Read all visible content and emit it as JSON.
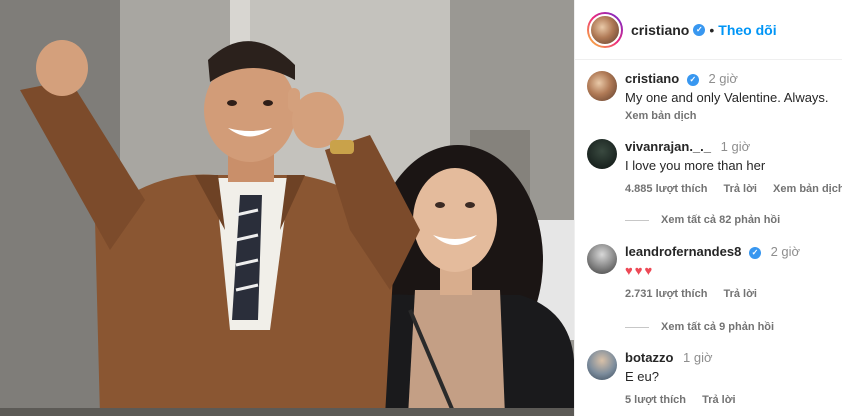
{
  "post": {
    "author": "cristiano",
    "follow_label": "Theo dõi",
    "dot": "•"
  },
  "caption": {
    "username": "cristiano",
    "time": "2 giờ",
    "text": "My one and only Valentine. Always.",
    "translate_label": "Xem bản dịch"
  },
  "comments": [
    {
      "username": "vivanrajan._._",
      "time": "1 giờ",
      "text": "I love you more than her",
      "likes": "4.885 lượt thích",
      "reply_label": "Trả lời",
      "translate_label": "Xem bản dịch",
      "view_replies": "Xem tất cả 82 phản hồi"
    },
    {
      "username": "leandrofernandes8",
      "time": "2 giờ",
      "text": "♥♥♥",
      "likes": "2.731 lượt thích",
      "reply_label": "Trả lời",
      "view_replies": "Xem tất cả 9 phản hồi"
    },
    {
      "username": "botazzo",
      "time": "1 giờ",
      "text": "E eu?",
      "likes": "5 lượt thích",
      "reply_label": "Trả lời"
    }
  ],
  "icons": {
    "verified": "verified-badge-icon"
  },
  "colors": {
    "accent": "#0095f6",
    "verified": "#3897f0",
    "heart": "#ed4956"
  }
}
